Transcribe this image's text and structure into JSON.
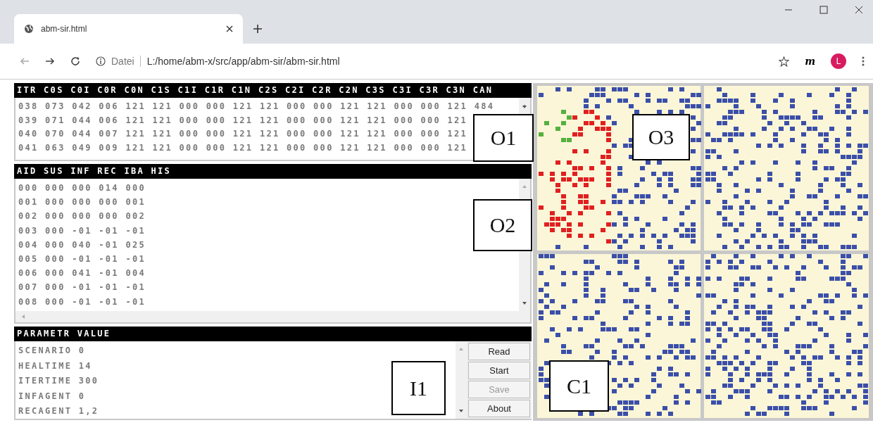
{
  "browser": {
    "tab": {
      "title": "abm-sir.html",
      "selected": true
    },
    "address": {
      "scheme_label": "Datei",
      "url": "L:/home/abm-x/src/app/abm-sir/abm-sir.html"
    },
    "extension": "m",
    "profile": "L"
  },
  "panels": [
    {
      "kind": "output",
      "header": "ITR C0S C0I C0R C0N C1S C1I C1R C1N C2S C2I C2R C2N C3S C3I C3R C3N CAN",
      "hscroll": false,
      "lines": [
        "038 073 042 006 121 121 000 000 121 121 000 000 121 121 000 000 121 484",
        "039 071 044 006 121 121 000 000 121 121 000 000 121 121 000 000 121",
        "040 070 044 007 121 121 000 000 121 121 000 000 121 121 000 000 121",
        "041 063 049 009 121 121 000 000 121 121 000 000 121 121 000 000 121"
      ]
    },
    {
      "kind": "output",
      "header": "AID SUS INF REC IBA HIS",
      "hscroll": true,
      "lines": [
        "000 000 000 014 000",
        "001 000 000 000 001",
        "002 000 000 000 002",
        "003 000 -01 -01 -01",
        "004 000 040 -01 025",
        "005 000 -01 -01 -01",
        "006 000 041 -01 004",
        "007 000 -01 -01 -01",
        "008 000 -01 -01 -01"
      ]
    },
    {
      "kind": "input",
      "header": "PARAMETR VALUE",
      "hscroll": false,
      "lines": [
        "SCENARIO 0",
        "HEALTIME 14",
        "ITERTIME 300",
        "INFAGENT 0",
        "RECAGENT 1,2"
      ]
    }
  ],
  "buttons": [
    {
      "label": "Read",
      "disabled": false
    },
    {
      "label": "Start",
      "disabled": false
    },
    {
      "label": "Save",
      "disabled": true
    },
    {
      "label": "About",
      "disabled": false
    }
  ],
  "annotations": [
    "O1",
    "O2",
    "O3",
    "I1",
    "C1"
  ]
}
